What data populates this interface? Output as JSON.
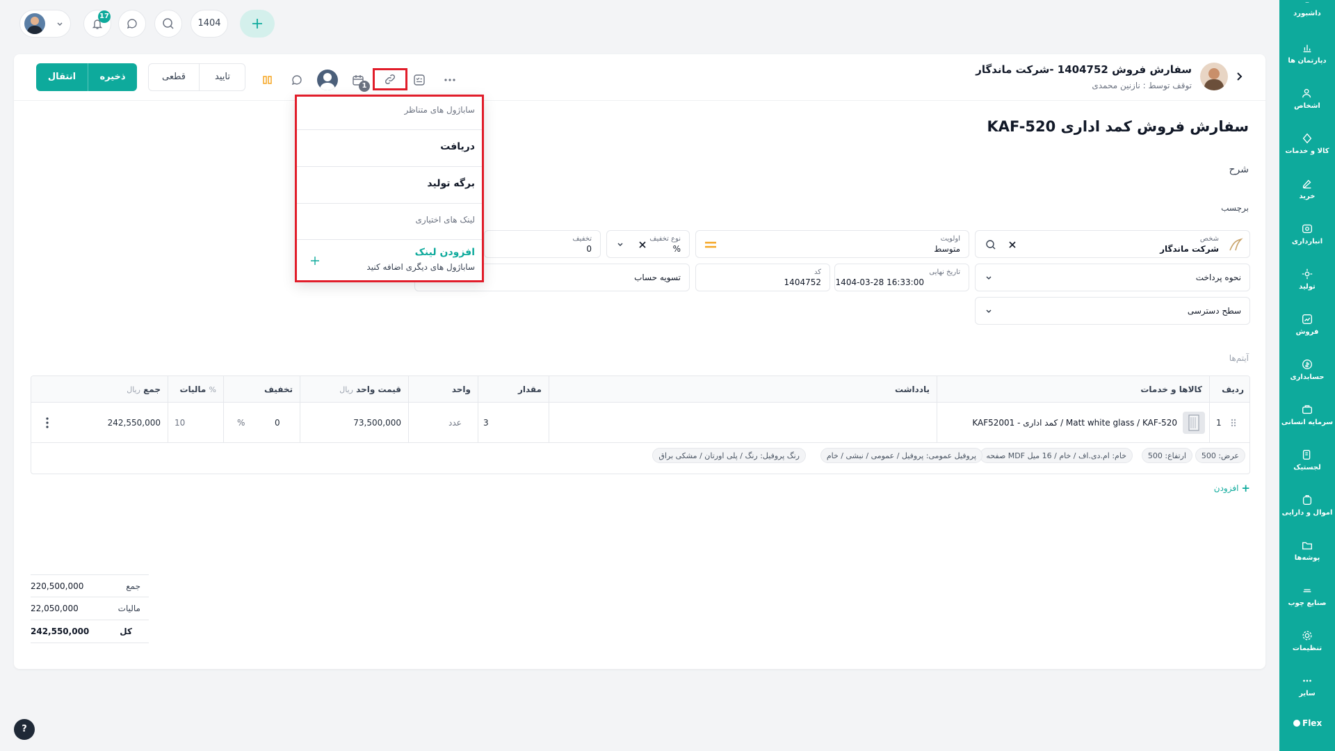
{
  "topbar": {
    "notification_count": "17",
    "year": "1404"
  },
  "sidebar": {
    "items": [
      {
        "label": "داشبورد",
        "icon": "dashboard-icon"
      },
      {
        "label": "دپارتمان ها",
        "icon": "chart-icon"
      },
      {
        "label": "اشخاص",
        "icon": "people-icon"
      },
      {
        "label": "کالا و خدمات",
        "icon": "box-icon"
      },
      {
        "label": "خرید",
        "icon": "purchase-icon"
      },
      {
        "label": "انبارداری",
        "icon": "warehouse-icon"
      },
      {
        "label": "تولید",
        "icon": "production-icon"
      },
      {
        "label": "فروش",
        "icon": "sales-icon"
      },
      {
        "label": "حسابداری",
        "icon": "accounting-icon"
      },
      {
        "label": "سرمایه انسانی",
        "icon": "hr-icon"
      },
      {
        "label": "لجستیک",
        "icon": "logistics-icon"
      },
      {
        "label": "اموال و دارایی",
        "icon": "assets-icon"
      },
      {
        "label": "پوشه‌ها",
        "icon": "folder-icon"
      },
      {
        "label": "صنایع چوب",
        "icon": "wood-icon"
      },
      {
        "label": "تنظیمات",
        "icon": "gear-icon"
      },
      {
        "label": "سایر",
        "icon": "more-icon"
      }
    ],
    "brand": "Flex"
  },
  "header": {
    "title": "سفارش فروش 1404752 -شرکت ماندگار",
    "subtitle": "توقف توسط : نازنین محمدی",
    "buttons": {
      "transfer": "انتقال",
      "save": "ذخیره",
      "final": "قطعی",
      "confirm": "تایید"
    },
    "calendar_badge": "1"
  },
  "dropdown": {
    "section_related": "ساباژول های متناظر",
    "item_receive": "دریافت",
    "item_production": "برگه تولید",
    "section_optional": "لینک های اختیاری",
    "add_title": "افزودن لینک",
    "add_sub": "ساباژول های دیگری اضافه کنید"
  },
  "form": {
    "page_title": "سفارش فروش کمد اداری KAF-520",
    "description_label": "شرح",
    "tag_label": "برچسب",
    "person_label": "شخص",
    "person_value": "شرکت ماندگار",
    "priority_label": "اولویت",
    "priority_value": "متوسط",
    "discount_type_label": "نوع تخفیف",
    "discount_type_value": "%",
    "discount_label": "تخفیف",
    "discount_value": "0",
    "payment_label": "نحوه پرداخت",
    "final_date_label": "تاریخ نهایی",
    "final_date_value": "1404-03-28 16:33:00",
    "code_label": "کد",
    "code_value": "1404752",
    "settlement_value": "تسویه حساب",
    "access_label": "سطح دسترسی"
  },
  "items": {
    "section_label": "آیتم‌ها",
    "columns": {
      "row": "ردیف",
      "goods": "کالاها و خدمات",
      "note": "یادداشت",
      "qty": "مقدار",
      "unit": "واحد",
      "unit_price": "قیمت واحد",
      "unit_price_cur": "ریال",
      "discount": "تخفیف",
      "tax": "مالیات",
      "tax_unit": "%",
      "sum": "جمع",
      "sum_cur": "ریال"
    },
    "rows": [
      {
        "row": "1",
        "goods": "KAF52001 - کمد اداری / Matt white glass / KAF-520",
        "note": "",
        "qty": "3",
        "unit": "عدد",
        "unit_price": "73,500,000",
        "discount": "0",
        "discount_unit": "%",
        "tax": "10",
        "sum": "242,550,000"
      }
    ],
    "attributes": [
      "عرض: 500",
      "ارتفاع: 500",
      "صفحه MDF خام: ام.دی.اف / خام / 16 میل",
      "پروفیل عمومی: پروفیل / عمومی / نبشی / خام",
      "رنگ پروفیل: رنگ / پلی اورتان / مشکی براق"
    ],
    "add_label": "افزودن"
  },
  "totals": {
    "sum_label": "جمع",
    "sum_value": "220,500,000",
    "tax_label": "مالیات",
    "tax_value": "22,050,000",
    "total_label": "کل",
    "total_value": "242,550,000"
  },
  "help": "?"
}
